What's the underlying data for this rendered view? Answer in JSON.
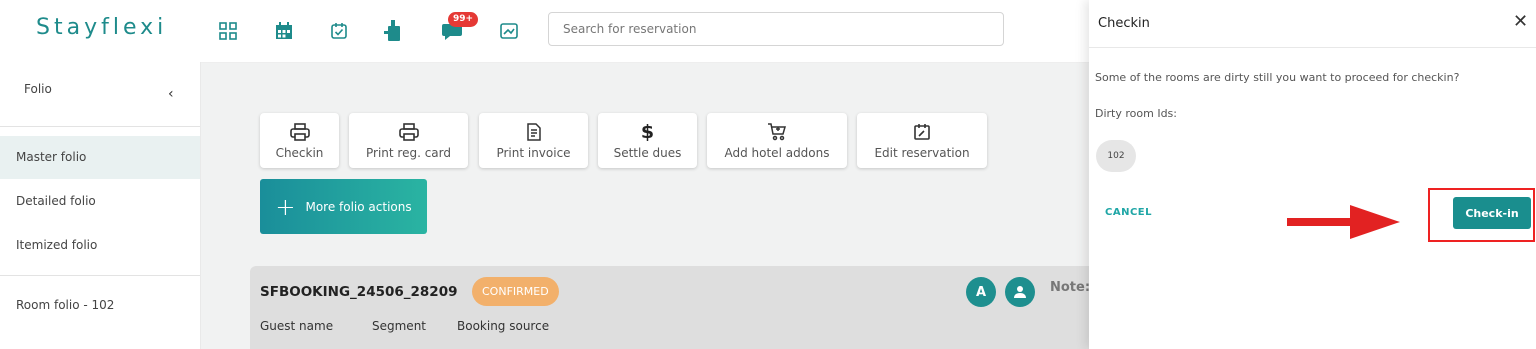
{
  "brand": {
    "name": "Stayflexi",
    "color": "#1e8b8b"
  },
  "topbar": {
    "icons": [
      "dashboard-icon",
      "calendar-icon",
      "checklist-icon",
      "housekeeping-icon",
      "messages-icon",
      "reports-icon"
    ],
    "notification_badge": "99+",
    "search": {
      "placeholder": "Search for reservation",
      "value": ""
    }
  },
  "sidebar": {
    "title": "Folio",
    "items": [
      {
        "label": "Master folio",
        "active": true
      },
      {
        "label": "Detailed folio",
        "active": false
      },
      {
        "label": "Itemized folio",
        "active": false
      },
      {
        "label": "Room folio - 102",
        "active": false
      }
    ]
  },
  "actions": [
    {
      "label": "Checkin",
      "icon": "printer-icon"
    },
    {
      "label": "Print reg. card",
      "icon": "printer-icon"
    },
    {
      "label": "Print invoice",
      "icon": "invoice-icon"
    },
    {
      "label": "Settle dues",
      "icon": "dollar-icon"
    },
    {
      "label": "Add hotel addons",
      "icon": "cart-icon"
    },
    {
      "label": "Edit reservation",
      "icon": "edit-calendar-icon"
    }
  ],
  "more_actions_label": "More folio actions",
  "booking": {
    "id": "SFBOOKING_24506_28209",
    "status": "CONFIRMED",
    "avatar_letter": "A",
    "notes_label": "Note:",
    "columns": [
      "Guest name",
      "Segment",
      "Booking source"
    ]
  },
  "checkin_dialog": {
    "title": "Checkin",
    "message": "Some of the rooms are dirty still you want to proceed for checkin?",
    "dirty_label": "Dirty room Ids:",
    "dirty_rooms": [
      "102"
    ],
    "cancel_label": "CANCEL",
    "confirm_label": "Check-in"
  },
  "colors": {
    "accent": "#1a8e8e",
    "status": "#f2b06b",
    "annotation": "#e22222"
  }
}
